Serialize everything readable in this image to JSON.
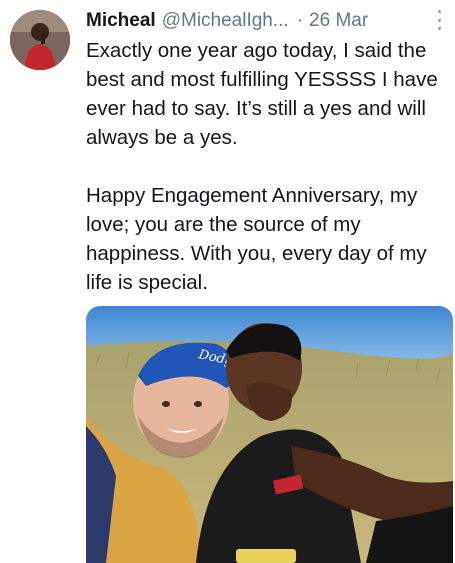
{
  "tweet": {
    "author_name": "Micheal",
    "handle": "@MichealIgh...",
    "separator": "·",
    "date": "26 Mar",
    "paragraphs": [
      "Exactly one year ago today, I said the best and most fulfilling YESSSS I have ever had to say. It’s still a yes and will always be a yes.",
      "Happy Engagement Anniversary, my love; you are the source of my happiness. With you, every day of my life is special."
    ],
    "cap_text": "Dodgers"
  },
  "icons": {
    "more": "more-vertical-icon"
  },
  "colors": {
    "text": "#14171a",
    "secondary": "#657786",
    "sky": "#4a8fd6",
    "grass": "#b7a56a"
  }
}
